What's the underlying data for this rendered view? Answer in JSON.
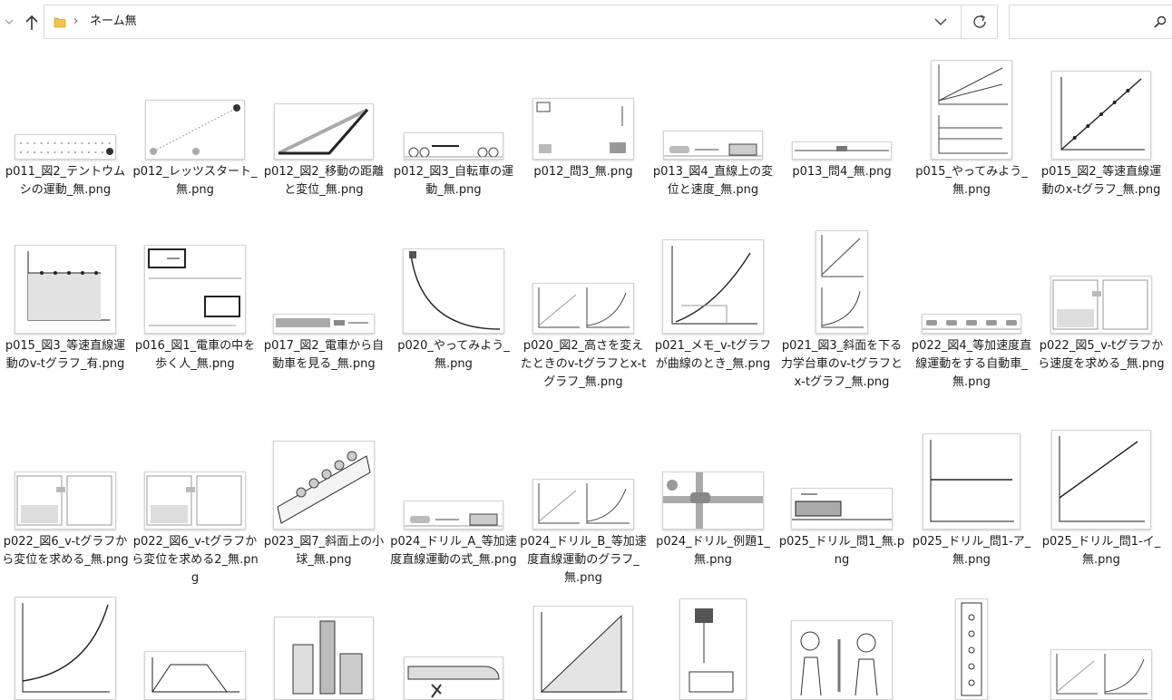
{
  "address_bar": {
    "breadcrumb_separator": "›",
    "current_folder": "ネーム無",
    "dropdown_icon": "chevron-down-icon",
    "refresh_icon": "refresh-icon"
  },
  "search": {
    "placeholder": "",
    "icon": "search-icon"
  },
  "files": [
    {
      "name": "p011_図2_テントウムシの運動_無.png",
      "thumb": "dots"
    },
    {
      "name": "p012_レッツスタート_無.png",
      "thumb": "bugline"
    },
    {
      "name": "p012_図2_移動の距離と変位_無.png",
      "thumb": "vector"
    },
    {
      "name": "p012_図3_自転車の運動_無.png",
      "thumb": "bikes"
    },
    {
      "name": "p012_問3_無.png",
      "thumb": "map"
    },
    {
      "name": "p013_図4_直線上の変位と速度_無.png",
      "thumb": "cars"
    },
    {
      "name": "p013_問4_無.png",
      "thumb": "track"
    },
    {
      "name": "p015_やってみよう_無.png",
      "thumb": "xtgraphs"
    },
    {
      "name": "p015_図2_等速直線運動のx-tグラフ_無.png",
      "thumb": "linegraph"
    },
    {
      "name": "p015_図3_等速直線運動のv-tグラフ_有.png",
      "thumb": "vtflat"
    },
    {
      "name": "p016_図1_電車の中を歩く人_無.png",
      "thumb": "train"
    },
    {
      "name": "p017_図2_電車から自動車を見る_無.png",
      "thumb": "trainstrip"
    },
    {
      "name": "p020_やってみよう_無.png",
      "thumb": "ramp"
    },
    {
      "name": "p020_図2_高さを変えたときのv-tグラフとx-tグラフ_無.png",
      "thumb": "twographs"
    },
    {
      "name": "p021_メモ_v-tグラフが曲線のとき_無.png",
      "thumb": "curvegraph"
    },
    {
      "name": "p021_図3_斜面を下る力学台車のv-tグラフとx-tグラフ_無.png",
      "thumb": "stackgraphs"
    },
    {
      "name": "p022_図4_等加速度直線運動をする自動車_無.png",
      "thumb": "carstrip"
    },
    {
      "name": "p022_図5_v-tグラフから速度を求める_無.png",
      "thumb": "twopanel"
    },
    {
      "name": "p022_図6_v-tグラフから変位を求める_無.png",
      "thumb": "twopanel"
    },
    {
      "name": "p022_図6_v-tグラフから変位を求める2_無.png",
      "thumb": "twopanel"
    },
    {
      "name": "p023_図7_斜面上の小球_無.png",
      "thumb": "incline"
    },
    {
      "name": "p024_ドリル_A_等加速度直線運動の式_無.png",
      "thumb": "cars"
    },
    {
      "name": "p024_ドリル_B_等加速度直線運動のグラフ_無.png",
      "thumb": "twographs"
    },
    {
      "name": "p024_ドリル_例題1_無.png",
      "thumb": "crossing"
    },
    {
      "name": "p025_ドリル_問1_無.png",
      "thumb": "trainside"
    },
    {
      "name": "p025_ドリル_問1-ア_無.png",
      "thumb": "flatline"
    },
    {
      "name": "p025_ドリル_問1-イ_無.png",
      "thumb": "slopeline"
    },
    {
      "name": "",
      "thumb": "expcurve"
    },
    {
      "name": "",
      "thumb": "trapezoid"
    },
    {
      "name": "",
      "thumb": "buildings"
    },
    {
      "name": "",
      "thumb": "runner"
    },
    {
      "name": "",
      "thumb": "triangle"
    },
    {
      "name": "",
      "thumb": "bottle"
    },
    {
      "name": "",
      "thumb": "people"
    },
    {
      "name": "",
      "thumb": "column"
    },
    {
      "name": "",
      "thumb": "twographs"
    }
  ]
}
